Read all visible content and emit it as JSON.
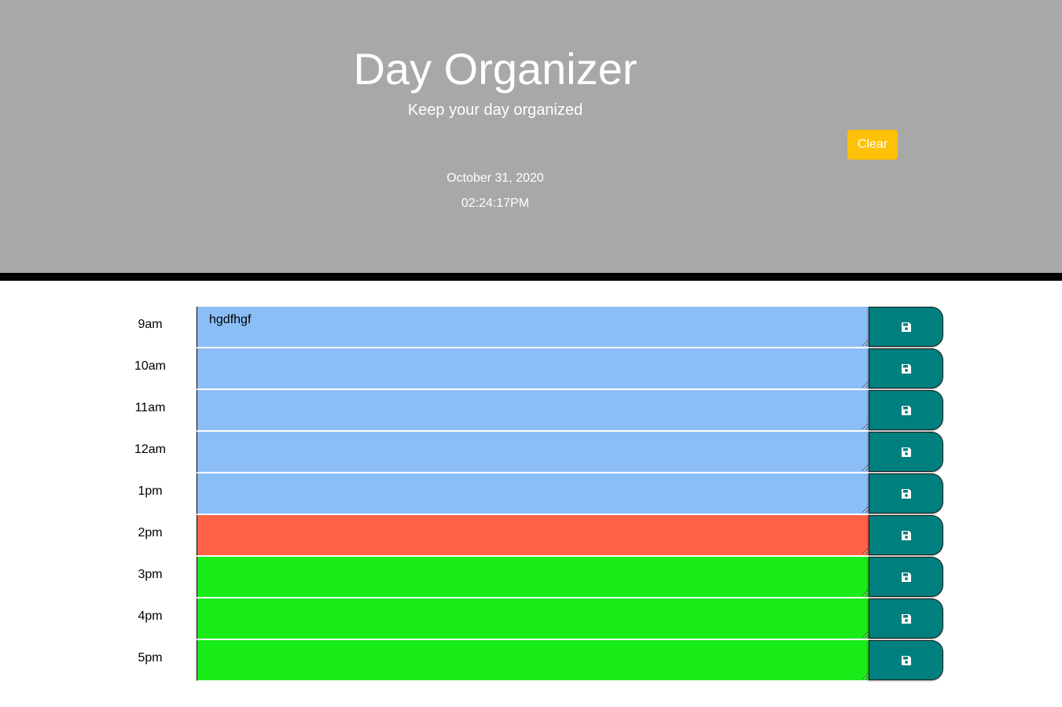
{
  "header": {
    "title": "Day Organizer",
    "subtitle": "Keep your day organized",
    "clear_label": "Clear",
    "date": "October 31, 2020",
    "time": "02:24:17PM"
  },
  "colors": {
    "header_bg": "#a8a8a8",
    "clear_button": "#ffc107",
    "past": "#8bbef7",
    "present": "#ff6347",
    "future": "#19ec19",
    "save_button": "#007f7f"
  },
  "rows": [
    {
      "hour": "9am",
      "text": "hgdfhgf",
      "state": "past"
    },
    {
      "hour": "10am",
      "text": "",
      "state": "past"
    },
    {
      "hour": "11am",
      "text": "",
      "state": "past"
    },
    {
      "hour": "12am",
      "text": "",
      "state": "past"
    },
    {
      "hour": "1pm",
      "text": "",
      "state": "past"
    },
    {
      "hour": "2pm",
      "text": "",
      "state": "present"
    },
    {
      "hour": "3pm",
      "text": "",
      "state": "future"
    },
    {
      "hour": "4pm",
      "text": "",
      "state": "future"
    },
    {
      "hour": "5pm",
      "text": "",
      "state": "future"
    }
  ],
  "save_icon": "floppy-disk-icon"
}
